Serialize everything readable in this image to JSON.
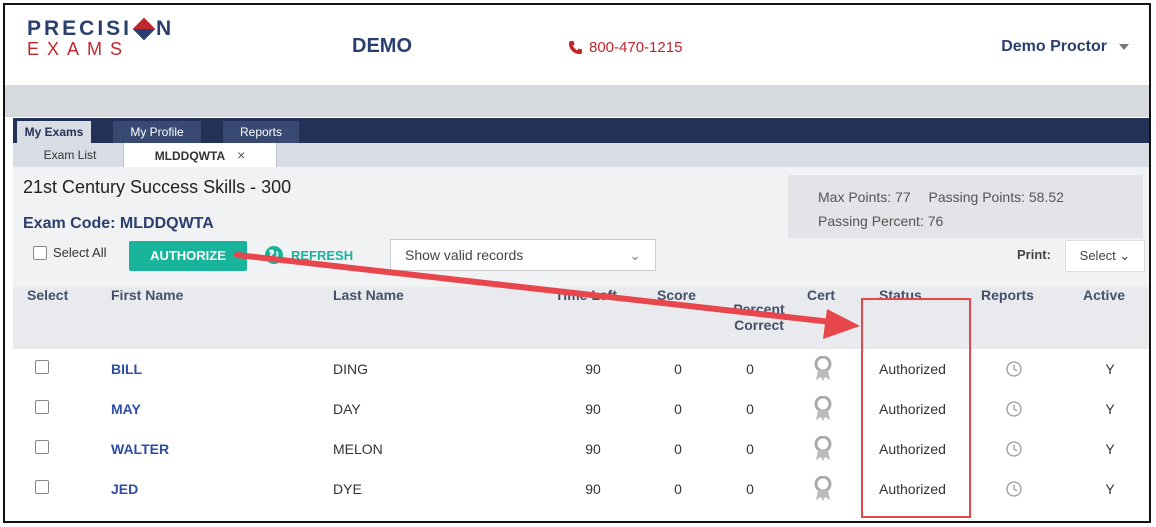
{
  "header": {
    "logo_top_left": "PRECISI",
    "logo_top_right": "N",
    "logo_bottom": "EXAMS",
    "site_name": "DEMO",
    "phone": "800-470-1215",
    "user_name": "Demo Proctor"
  },
  "nav": {
    "tabs": [
      {
        "label": "My Exams",
        "active": true
      },
      {
        "label": "My Profile",
        "active": false
      },
      {
        "label": "Reports",
        "active": false
      }
    ]
  },
  "subtabs": [
    {
      "label": "Exam List",
      "active": false
    },
    {
      "label": "MLDDQWTA",
      "active": true,
      "close": "×"
    }
  ],
  "exam": {
    "title": "21st Century Success Skills - 300",
    "code_label": "Exam Code: MLDDQWTA",
    "max_points": "Max Points: 77",
    "passing_points": "Passing Points: 58.52",
    "passing_percent": "Passing Percent: 76"
  },
  "toolbar": {
    "select_all": "Select All",
    "authorize": "AUTHORIZE",
    "refresh": "REFRESH",
    "filter_value": "Show valid records",
    "print_label": "Print:",
    "print_value": "Select"
  },
  "table": {
    "headers": {
      "select": "Select",
      "first_name": "First Name",
      "last_name": "Last Name",
      "time_left": "Time Left",
      "score": "Score",
      "percent_correct_1": "Percent",
      "percent_correct_2": "Correct",
      "cert": "Cert",
      "status": "Status",
      "reports": "Reports",
      "active": "Active"
    },
    "rows": [
      {
        "first": "BILL",
        "last": "DING",
        "time_left": "90",
        "score": "0",
        "percent": "0",
        "status": "Authorized",
        "active": "Y"
      },
      {
        "first": "MAY",
        "last": "DAY",
        "time_left": "90",
        "score": "0",
        "percent": "0",
        "status": "Authorized",
        "active": "Y"
      },
      {
        "first": "WALTER",
        "last": "MELON",
        "time_left": "90",
        "score": "0",
        "percent": "0",
        "status": "Authorized",
        "active": "Y"
      },
      {
        "first": "JED",
        "last": "DYE",
        "time_left": "90",
        "score": "0",
        "percent": "0",
        "status": "Authorized",
        "active": "Y"
      }
    ]
  },
  "colors": {
    "brand_navy": "#2a3f6e",
    "brand_red": "#c0272d",
    "accent_teal": "#18b49b",
    "annotation_red": "#e8464d"
  }
}
